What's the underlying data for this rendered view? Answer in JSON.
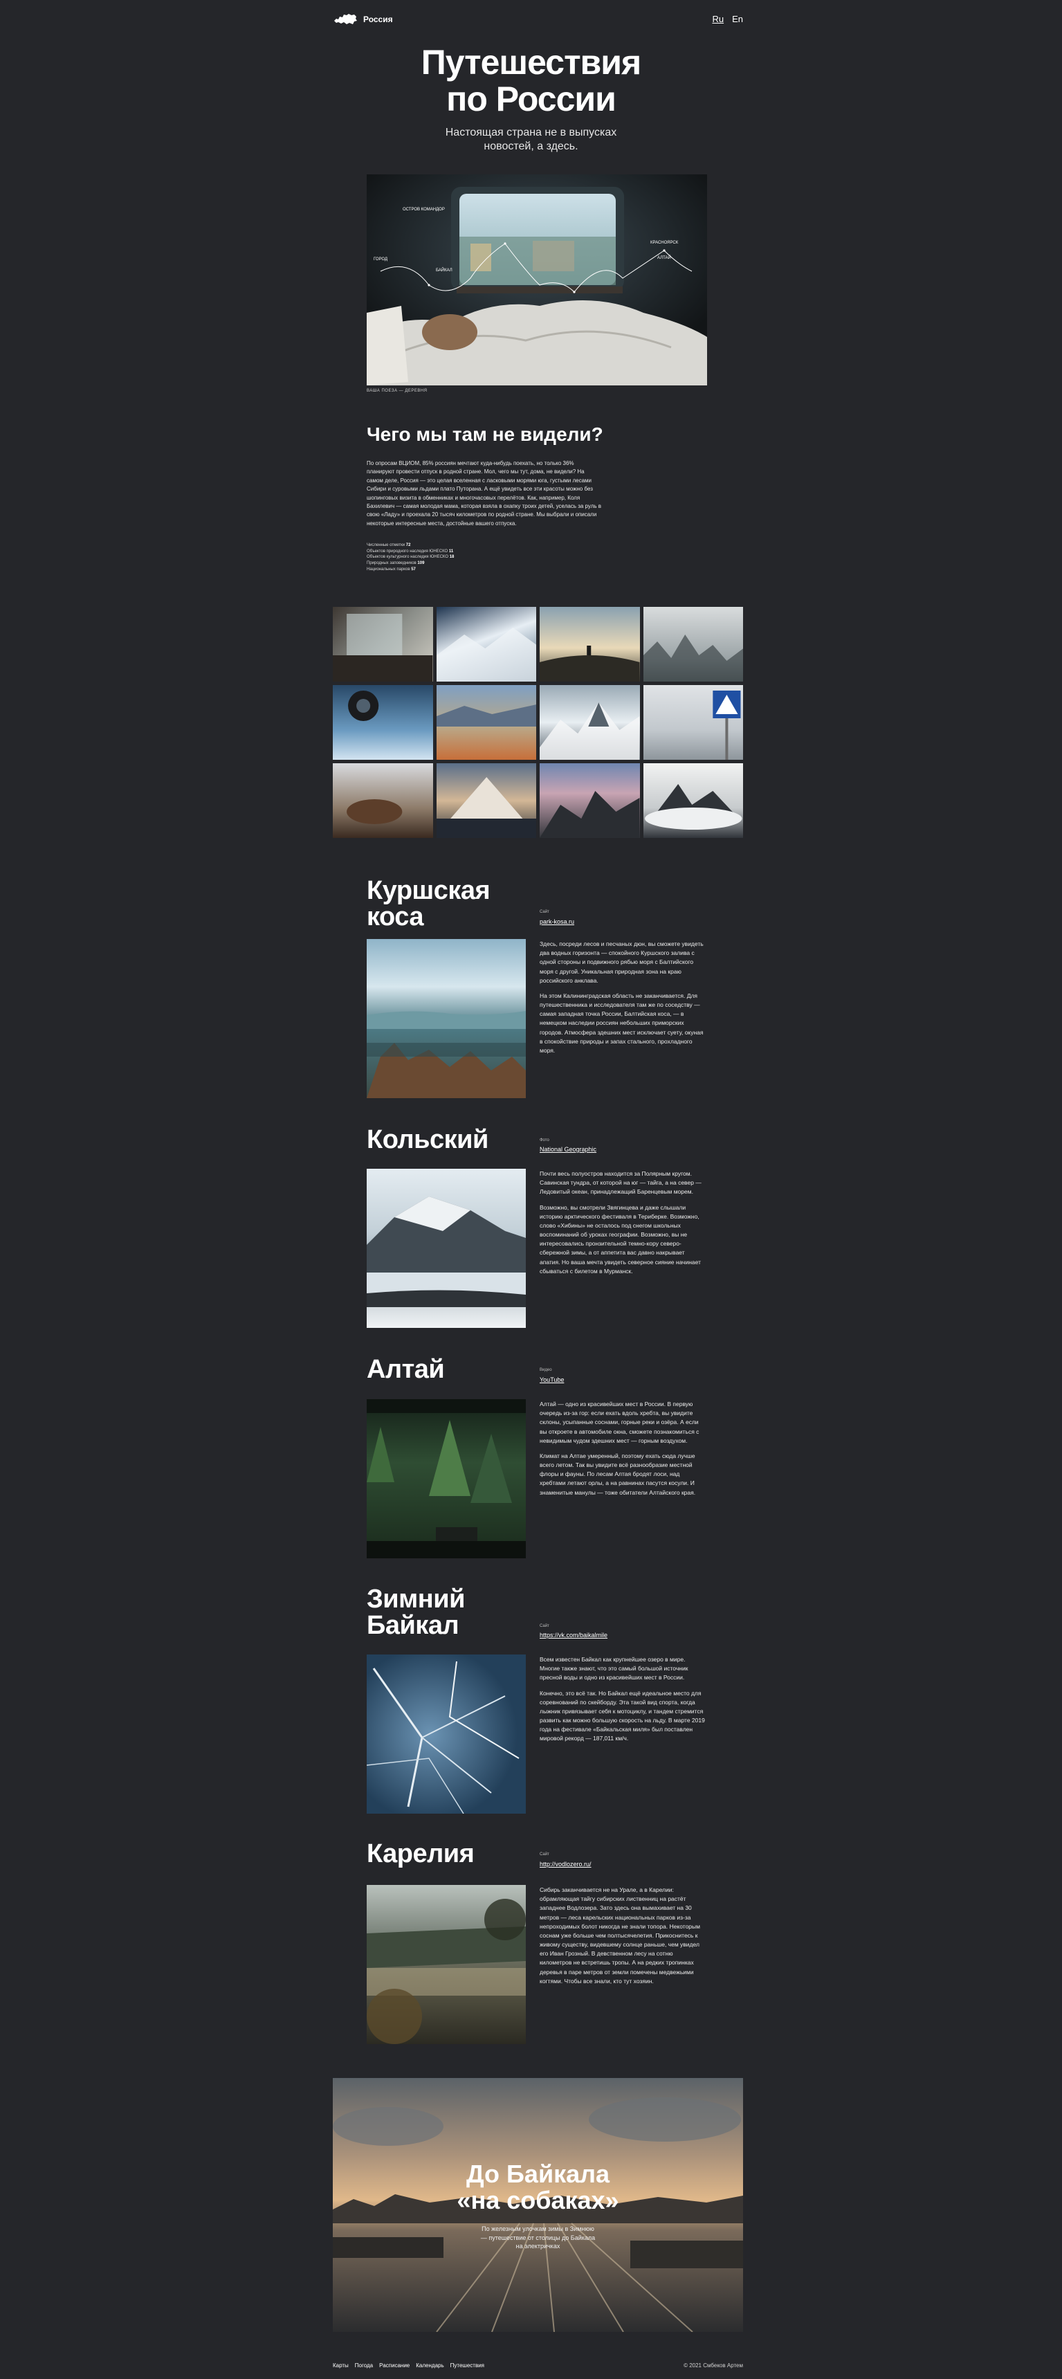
{
  "header": {
    "logo_text": "Россия",
    "lang": [
      "Ru",
      "En"
    ]
  },
  "hero": {
    "title_line1": "Путешествия",
    "title_line2": "по России",
    "subtitle_line1": "Настоящая страна не в выпусках",
    "subtitle_line2": "новостей, а здесь.",
    "caption": "ВАША ПОЕЗА — ДЕРЕВНЯ",
    "map_labels": [
      "ОСТРОВ КОМАНДОР",
      "ГОРОД",
      "БАЙКАЛ",
      "КРАСНОЯРСК",
      "АЛТАЙ"
    ]
  },
  "intro": {
    "title": "Чего мы там не видели?",
    "text": "По опросам ВЦИОМ, 85% россиян мечтают куда-нибудь поехать, но только 36% планируют провести отпуск в родной стране. Мол, чего мы тут, дома, не видели? На самом деле, Россия — это целая вселенная с ласковыми морями юга, густыми лесами Сибири и суровыми льдами плато Путорана. А ещё увидеть все эти красоты можно без шопинговых визита в обменниках и многочасовых перелётов. Как, например, Коля Бахилевич — самая молодая мама, которая взяла в охапку троих детей, уселась за руль в свою «Ладу» и проехала 20 тысяч километров по родной стране. Мы выбрали и описали некоторые интересные места, достойные вашего отпуска.",
    "stats": [
      {
        "label": "Численные отметки",
        "value": "72"
      },
      {
        "label": "Объектов природного наследия ЮНЕСКО",
        "value": "11"
      },
      {
        "label": "Объектов культурного наследия ЮНЕСКО",
        "value": "18"
      },
      {
        "label": "Природных заповедников",
        "value": "109"
      },
      {
        "label": "Национальных парков",
        "value": "57"
      }
    ]
  },
  "sections": [
    {
      "title_line1": "Куршская",
      "title_line2": "коса",
      "source_label": "Сайт",
      "link": "park-kosa.ru",
      "paragraphs": [
        "Здесь, посреди лесов и песчаных дюн, вы сможете увидеть два водных горизонта — спокойного Куршского залива с одной стороны и подвижного рябью моря с Балтийского моря с другой. Уникальная природная зона на краю российского анклава.",
        "На этом Калининградская область не заканчивается. Для путешественника и исследователя там же по соседству — самая западная точка России, Балтийская коса, — в немецком наследии россиян небольших приморских городов. Атмосфера здешних мест исключает суету, окуная в спокойствие природы и запах стального, прохладного моря."
      ]
    },
    {
      "title_line1": "Кольский",
      "title_line2": "",
      "source_label": "Фото",
      "link": "National Geographic",
      "paragraphs": [
        "Почти весь полуостров находится за Полярным кругом. Савинская тундра, от которой на юг — тайга, а на север — Ледовитый океан, принадлежащий Баренцевым морем.",
        "Возможно, вы смотрели Звягинцева и даже слышали историю арктического фестиваля в Териберке. Возможно, слово «Хибины» не осталось под снегом школьных воспоминаний об уроках географии. Возможно, вы не интересовались пронзительной темно-кору северо-сбережной зимы, а от аппетита вас давно накрывает апатия. Но ваша мечта увидеть северное сияние начинает сбываться с билетом в Мурманск."
      ]
    },
    {
      "title_line1": "Алтай",
      "title_line2": "",
      "source_label": "Видео",
      "link": "YouTube",
      "paragraphs": [
        "Алтай — одно из красивейших мест в России. В первую очередь из-за гор: если ехать вдоль хребта, вы увидите склоны, усыпанные соснами, горные реки и озёра. А если вы откроете в автомобиле окна, сможете познакомиться с невидимым чудом здешних мест — горным воздухом.",
        "Климат на Алтае умеренный, поэтому ехать сюда лучше всего летом. Так вы увидите всё разнообразие местной флоры и фауны. По лесам Алтая бродят лоси, над хребтами летают орлы, а на равнинах пасутся косули. И знаменитые манулы — тоже обитатели Алтайского края."
      ]
    },
    {
      "title_line1": "Зимний",
      "title_line2": "Байкал",
      "source_label": "Сайт",
      "link": "https://vk.com/baikalmile",
      "paragraphs": [
        "Всем известен Байкал как крупнейшее озеро в мире. Многие также знают, что это самый большой источник пресной воды и одно из красивейших мест в России.",
        "Конечно, это всё так. Но Байкал ещё идеальное место для соревнований по скейборду. Эта такой вид спорта, когда лыжник привязывает себя к мотоциклу, и тандем стремится развить как можно большую скорость на льду. В марте 2019 года на фестивале «Байкальская миля» был поставлен мировой рекорд — 187,011 км/ч."
      ]
    },
    {
      "title_line1": "Карелия",
      "title_line2": "",
      "source_label": "Сайт",
      "link": "http://vodlozero.ru/",
      "paragraphs": [
        "Сибирь заканчивается не на Урале, а в Карелии: обрамляющая тайгу сибирских лиственниц на растёт западнее Водлозера. Зато здесь она вымахивает на 30 метров — леса карельских национальных парков из-за непроходимых болот никогда не знали топора. Некоторым соснам уже больше чем полтысячелетия. Прикоснитесь к живому существу, видевшему солнце раньше, чем увидел его Иван Грозный. В девственном лесу на сотню километров не встретишь тропы. А на редких тропинках деревья в паре метров от земли помечены медвежьими когтями. Чтобы все знали, кто тут хозяин."
      ]
    }
  ],
  "banner": {
    "title_line1": "До Байкала",
    "title_line2": "«на собаках»",
    "subtitle_line1": "По железным улочкам зимы в Зимнюю",
    "subtitle_line2": "— путешествие от столицы до Байкала",
    "subtitle_line3": "на электричках"
  },
  "footer": {
    "nav": [
      "Карты",
      "Погода",
      "Расписание",
      "Календарь",
      "Путешествия"
    ],
    "copyright": "© 2021 Смбеков Артем"
  }
}
